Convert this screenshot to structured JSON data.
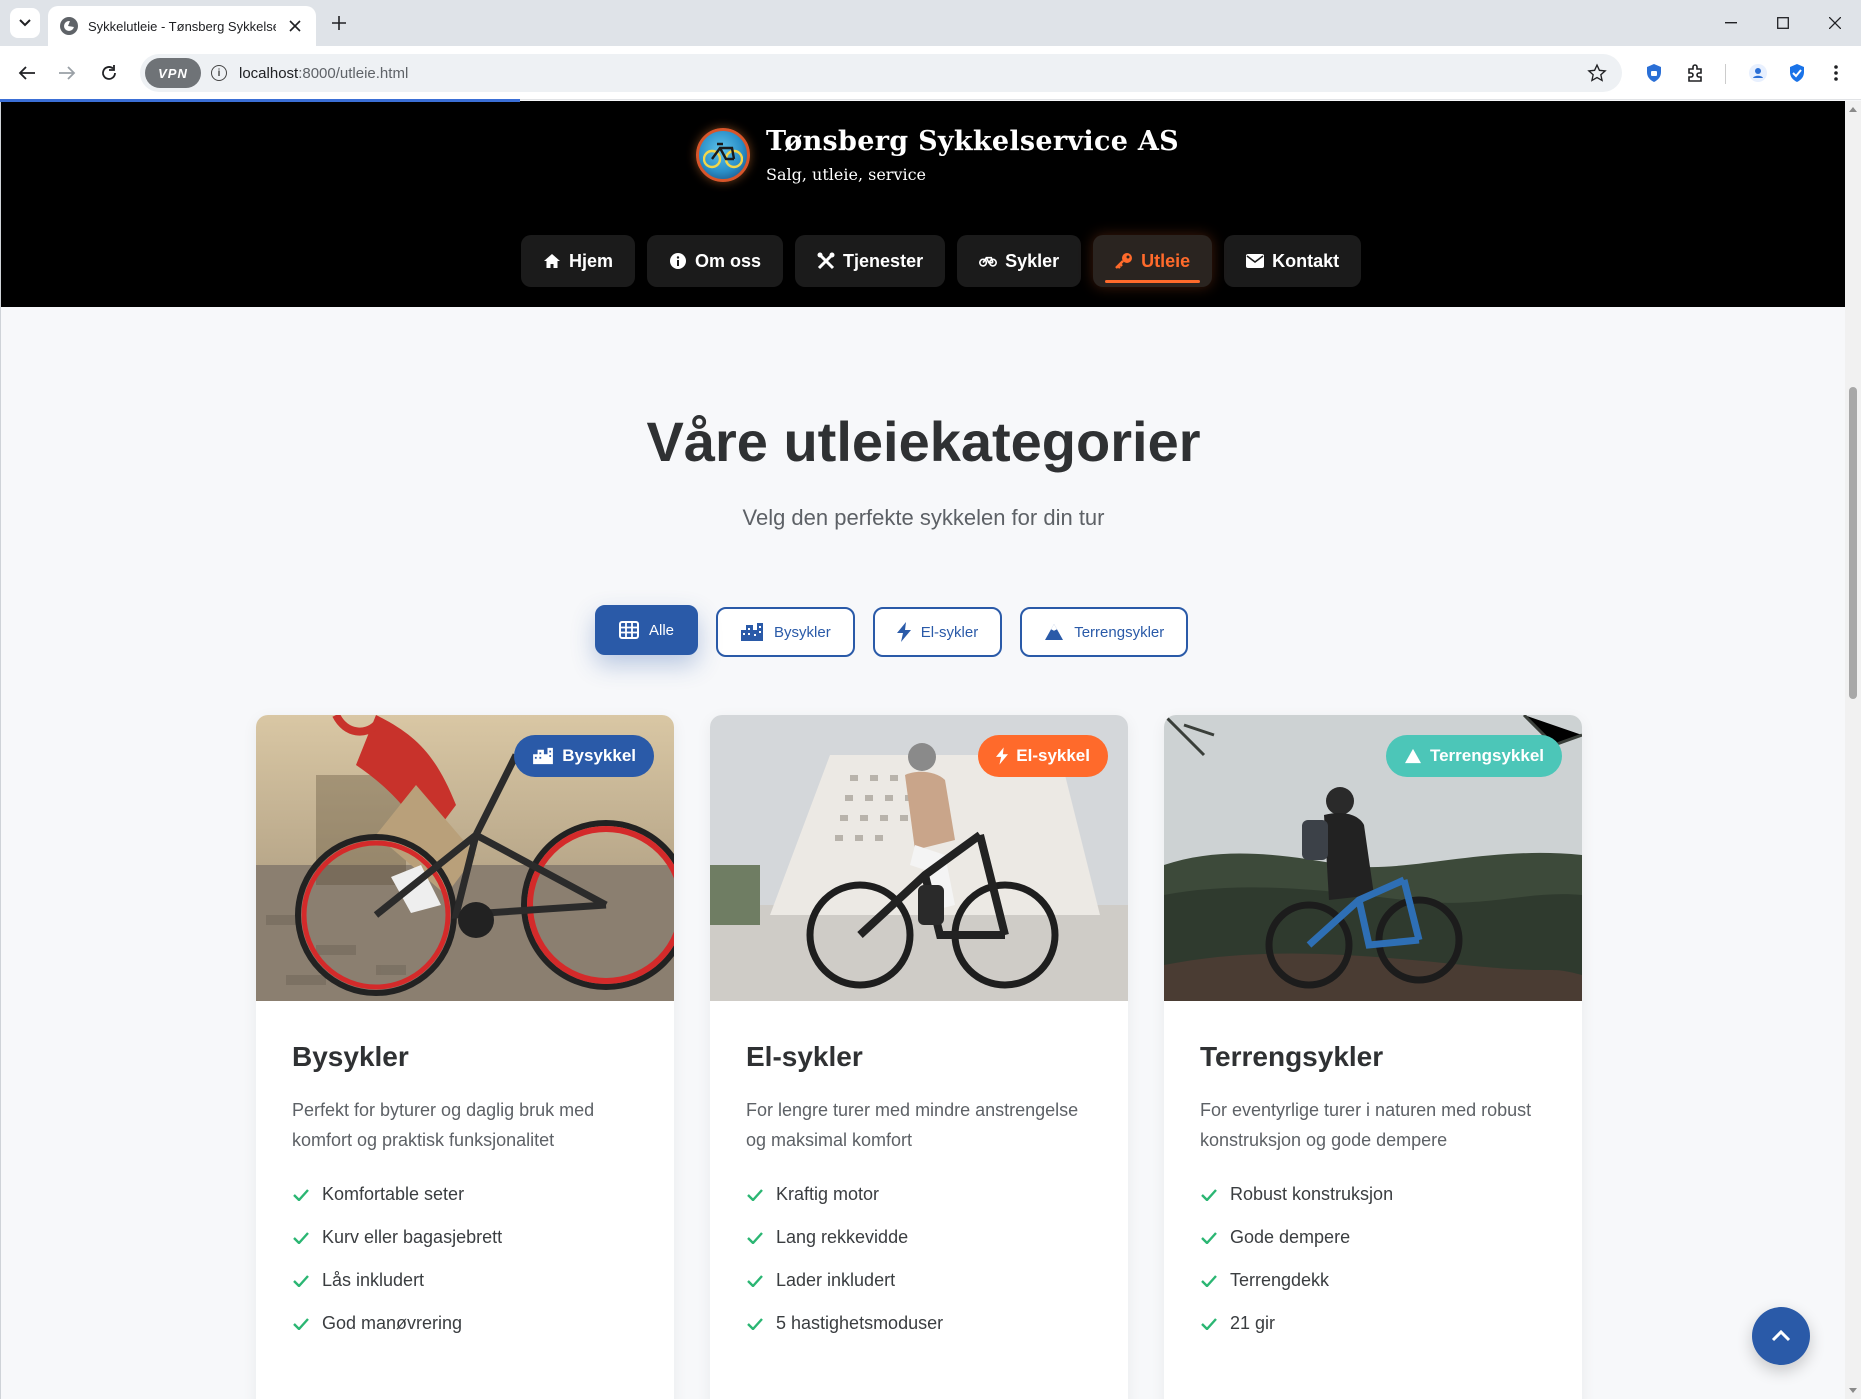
{
  "browser": {
    "tab_title": "Sykkelutleie - Tønsberg Sykkelservice AS",
    "url_host": "localhost",
    "url_path": ":8000/utleie.html",
    "vpn_label": "VPN"
  },
  "header": {
    "brand_title": "Tønsberg Sykkelservice AS",
    "brand_tagline": "Salg, utleie, service"
  },
  "nav": {
    "items": [
      {
        "label": "Hjem",
        "icon": "home-icon"
      },
      {
        "label": "Om oss",
        "icon": "info-icon"
      },
      {
        "label": "Tjenester",
        "icon": "tools-icon"
      },
      {
        "label": "Sykler",
        "icon": "bicycle-icon"
      },
      {
        "label": "Utleie",
        "icon": "key-icon",
        "active": true
      },
      {
        "label": "Kontakt",
        "icon": "envelope-icon"
      }
    ]
  },
  "main": {
    "heading": "Våre utleiekategorier",
    "subheading": "Velg den perfekte sykkelen for din tur",
    "filters": [
      {
        "label": "Alle",
        "icon": "grid-icon",
        "active": true
      },
      {
        "label": "Bysykler",
        "icon": "city-icon"
      },
      {
        "label": "El-sykler",
        "icon": "bolt-icon"
      },
      {
        "label": "Terrengsykler",
        "icon": "mountain-icon"
      }
    ],
    "cards": [
      {
        "badge": "Bysykkel",
        "badge_icon": "city-icon",
        "badge_color": "#2a5aa8",
        "title": "Bysykler",
        "description": "Perfekt for byturer og daglig bruk med komfort og praktisk funksjonalitet",
        "features": [
          "Komfortable seter",
          "Kurv eller bagasjebrett",
          "Lås inkludert",
          "God manøvrering"
        ]
      },
      {
        "badge": "El-sykkel",
        "badge_icon": "bolt-icon",
        "badge_color": "#ff6a2b",
        "title": "El-sykler",
        "description": "For lengre turer med mindre anstrengelse og maksimal komfort",
        "features": [
          "Kraftig motor",
          "Lang rekkevidde",
          "Lader inkludert",
          "5 hastighetsmoduser"
        ]
      },
      {
        "badge": "Terrengsykkel",
        "badge_icon": "mountain-icon",
        "badge_color": "#4cc6b8",
        "title": "Terrengsykler",
        "description": "For eventyrlige turer i naturen med robust konstruksjon og gode dempere",
        "features": [
          "Robust konstruksjon",
          "Gode dempere",
          "Terrengdekk",
          "21 gir"
        ]
      }
    ]
  },
  "colors": {
    "primary": "#2a5aa8",
    "accent": "#ff6a2b",
    "check": "#2bb673",
    "header_bg": "#000000"
  }
}
